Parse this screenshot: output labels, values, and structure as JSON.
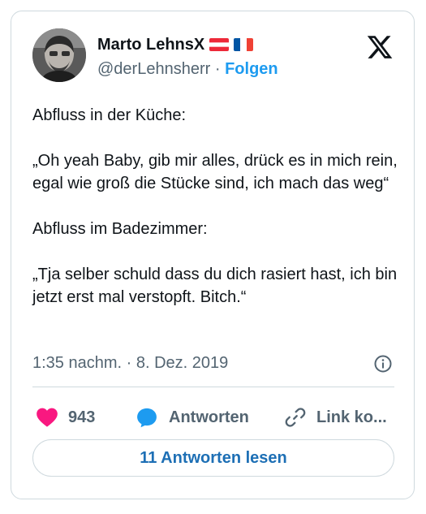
{
  "author": {
    "display_name": "Marto LehnsX",
    "flags": [
      "austria-flag",
      "france-flag"
    ],
    "handle": "@derLehnsherr",
    "separator": "·",
    "follow_label": "Folgen"
  },
  "platform": {
    "logo_icon": "x-logo-icon"
  },
  "tweet": {
    "paragraphs": [
      "Abfluss in der Küche:",
      "„Oh yeah Baby, gib mir alles, drück es in mich rein, egal wie groß die Stücke sind, ich mach das weg“",
      "Abfluss im Badezimmer:",
      "„Tja selber schuld dass du dich rasiert hast, ich bin jetzt erst mal verstopft. Bitch.“"
    ],
    "timestamp": "1:35 nachm. · 8. Dez. 2019"
  },
  "actions": {
    "like_count": "943",
    "reply_label": "Antworten",
    "link_label": "Link ko..."
  },
  "read_replies_label": "11 Antworten lesen",
  "colors": {
    "accent": "#1d9bf0",
    "like": "#f91880",
    "secondary_text": "#536471",
    "border": "#cfd9de"
  }
}
